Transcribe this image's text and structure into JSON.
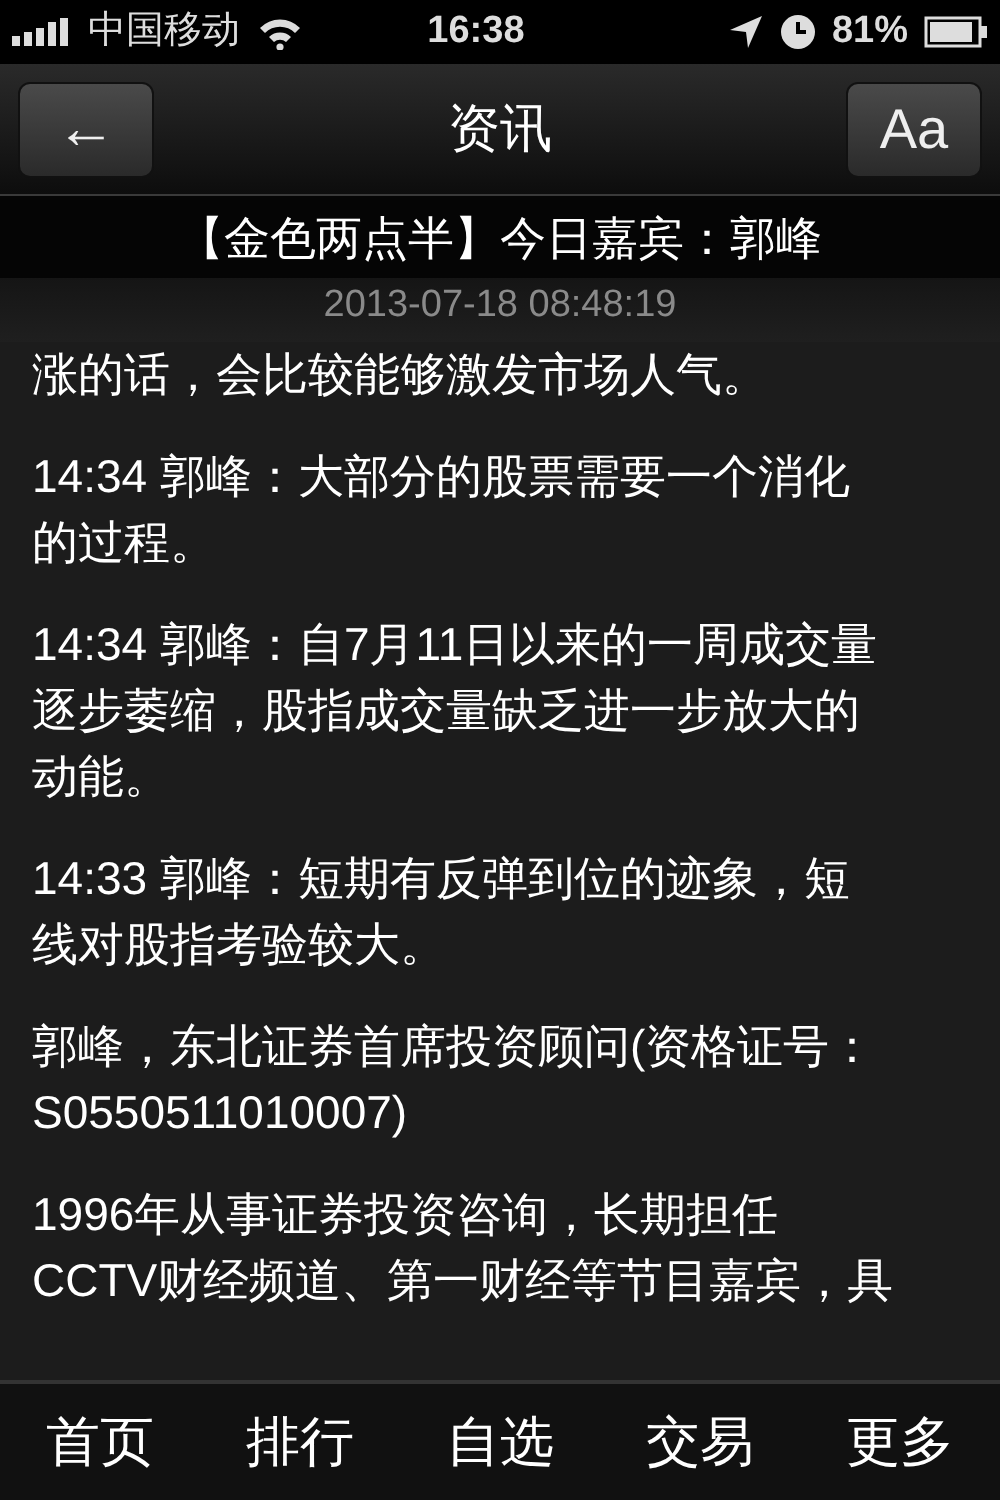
{
  "status_bar": {
    "carrier": "中国移动",
    "time": "16:38",
    "battery": "81%"
  },
  "nav_bar": {
    "title": "资讯",
    "back_button": "←",
    "font_button": "Aa"
  },
  "article": {
    "title": "【金色两点半】今日嘉宾：郭峰",
    "date": "2013-07-18 08:48:19",
    "paragraphs": [
      {
        "lines": [
          "涨的话，会比较能够激发市场人气。"
        ]
      },
      {
        "lines": [
          "14:34 郭峰：大部分的股票需要一个消化",
          "的过程。"
        ]
      },
      {
        "lines": [
          "14:34 郭峰：自7月11日以来的一周成交量",
          "逐步萎缩，股指成交量缺乏进一步放大的",
          "动能。"
        ]
      },
      {
        "lines": [
          "14:33 郭峰：短期有反弹到位的迹象，短",
          "线对股指考验较大。"
        ]
      },
      {
        "lines": [
          "郭峰，东北证券首席投资顾问(资格证号：",
          "S0550511010007)"
        ]
      },
      {
        "lines": [
          "1996年从事证券投资咨询，长期担任",
          "CCTV财经频道、第一财经等节目嘉宾，具"
        ]
      }
    ]
  },
  "tab_bar": [
    {
      "label": "首页"
    },
    {
      "label": "排行"
    },
    {
      "label": "自选"
    },
    {
      "label": "交易"
    },
    {
      "label": "更多"
    }
  ]
}
